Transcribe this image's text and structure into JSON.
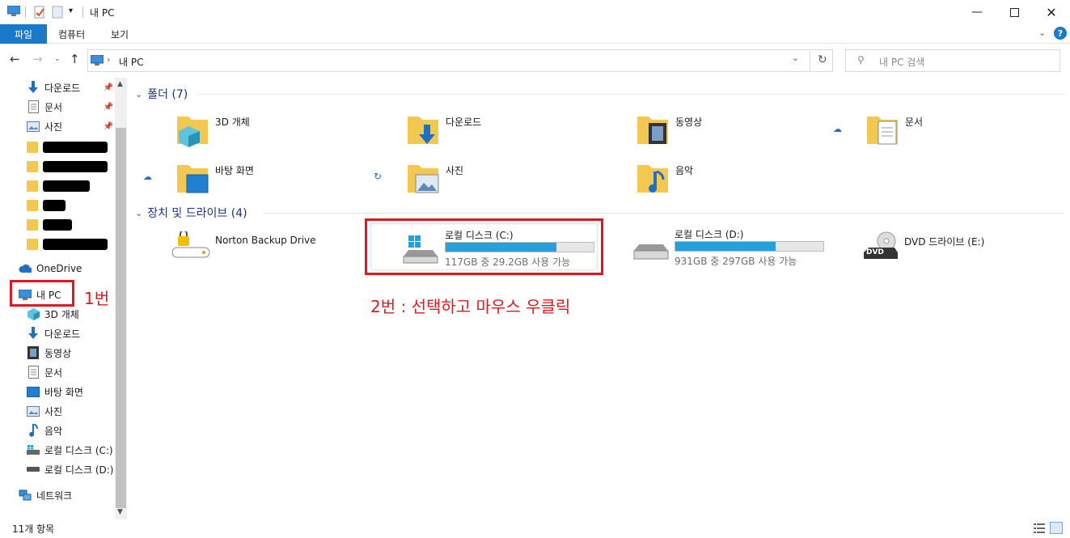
{
  "window": {
    "title": "내 PC",
    "controls": [
      "minimize-icon",
      "maximize-icon",
      "close-icon"
    ]
  },
  "ribbon": {
    "tabs": [
      {
        "label": "파일",
        "active": true
      },
      {
        "label": "컴퓨터",
        "active": false
      },
      {
        "label": "보기",
        "active": false
      }
    ]
  },
  "address": {
    "path": "내 PC",
    "search_placeholder": "내 PC 검색"
  },
  "sidebar": {
    "quick_access": [
      {
        "label": "다운로드",
        "icon": "download-arrow-icon",
        "pinned": true
      },
      {
        "label": "문서",
        "icon": "document-icon",
        "pinned": true
      },
      {
        "label": "사진",
        "icon": "picture-icon",
        "pinned": true
      }
    ],
    "onedrive_label": "OneDrive",
    "thispc_label": "내 PC",
    "thispc_items": [
      {
        "label": "3D 개체",
        "icon": "3d-objects-icon"
      },
      {
        "label": "다운로드",
        "icon": "download-arrow-icon"
      },
      {
        "label": "동영상",
        "icon": "video-icon"
      },
      {
        "label": "문서",
        "icon": "document-icon"
      },
      {
        "label": "바탕 화면",
        "icon": "desktop-icon"
      },
      {
        "label": "사진",
        "icon": "picture-icon"
      },
      {
        "label": "음악",
        "icon": "music-icon"
      },
      {
        "label": "로컬 디스크 (C:)",
        "icon": "windows-drive-icon"
      },
      {
        "label": "로컬 디스크 (D:)",
        "icon": "drive-icon"
      }
    ],
    "network_label": "네트워크"
  },
  "main": {
    "folders_header": "폴더 (7)",
    "folders": [
      {
        "label": "3D 개체",
        "icon": "3d-objects-folder-icon"
      },
      {
        "label": "다운로드",
        "icon": "downloads-folder-icon"
      },
      {
        "label": "동영상",
        "icon": "videos-folder-icon"
      },
      {
        "label": "문서",
        "icon": "documents-folder-icon",
        "status": "cloud-icon"
      },
      {
        "label": "바탕 화면",
        "icon": "desktop-folder-icon",
        "status": "cloud-icon"
      },
      {
        "label": "사진",
        "icon": "pictures-folder-icon",
        "status": "sync-icon"
      },
      {
        "label": "음악",
        "icon": "music-folder-icon"
      }
    ],
    "drives_header": "장치 및 드라이브 (4)",
    "drives": [
      {
        "label": "Norton Backup Drive",
        "icon": "norton-drive-icon"
      },
      {
        "label": "로컬 디스크 (C:)",
        "sub": "117GB 중 29.2GB 사용 가능",
        "used_fraction": 0.75,
        "icon": "windows-drive-icon"
      },
      {
        "label": "로컬 디스크 (D:)",
        "sub": "931GB 중 297GB 사용 가능",
        "used_fraction": 0.68,
        "icon": "drive-icon"
      },
      {
        "label": "DVD 드라이브 (E:)",
        "icon": "dvd-drive-icon",
        "dvd_text": "DVD"
      }
    ]
  },
  "annotations": {
    "step1": "1번",
    "step2": "2번 : 선택하고 마우스 우클릭"
  },
  "status": {
    "item_count": "11개 항목"
  },
  "colors": {
    "accent": "#1979ca",
    "annotation_red": "#e0171f",
    "drive_fill": "#26a0da",
    "folder_yellow": "#f3c850"
  }
}
